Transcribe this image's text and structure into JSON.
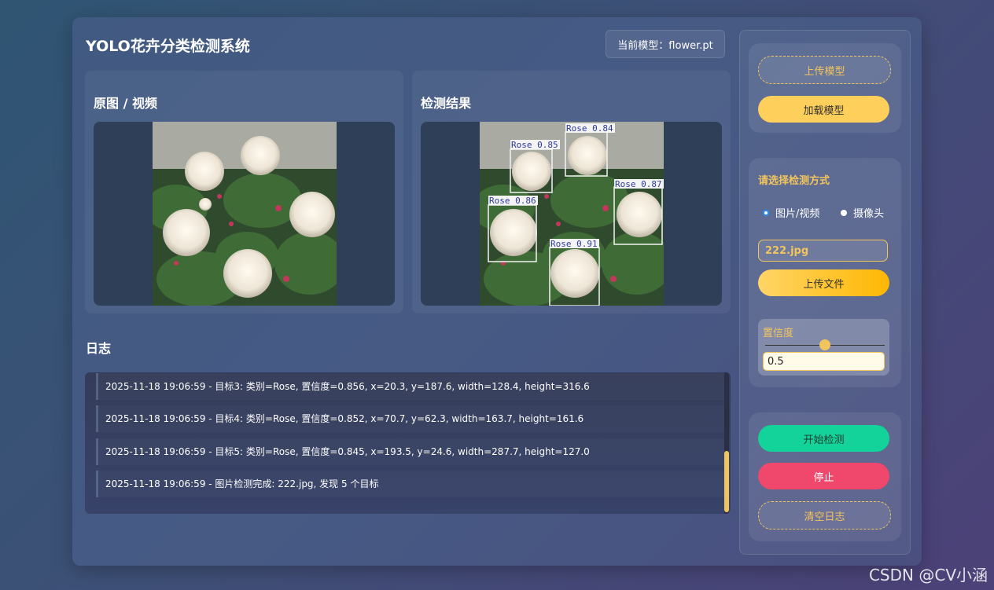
{
  "app": {
    "title": "YOLO花卉分类检测系统",
    "model_badge": "当前模型：flower.pt"
  },
  "panels": {
    "original_title": "原图 / 视频",
    "result_title": "检测结果"
  },
  "detections": [
    {
      "label": "Rose 0.85"
    },
    {
      "label": "Rose 0.84"
    },
    {
      "label": "Rose 0.87"
    },
    {
      "label": "Rose 0.86"
    },
    {
      "label": "Rose 0.91"
    }
  ],
  "log": {
    "title": "日志",
    "lines": [
      "2025-11-18 19:06:59 - 目标3: 类别=Rose, 置信度=0.856, x=20.3, y=187.6, width=128.4, height=316.6",
      "2025-11-18 19:06:59 - 目标4: 类别=Rose, 置信度=0.852, x=70.7, y=62.3, width=163.7, height=161.6",
      "2025-11-18 19:06:59 - 目标5: 类别=Rose, 置信度=0.845, x=193.5, y=24.6, width=287.7, height=127.0",
      "2025-11-18 19:06:59 - 图片检测完成: 222.jpg, 发现 5 个目标"
    ]
  },
  "sidebar": {
    "upload_model": "上传模型",
    "load_model": "加载模型",
    "detect_mode_title": "请选择检测方式",
    "mode_image": "图片/视频",
    "mode_camera": "摄像头",
    "file_name": "222.jpg",
    "upload_file": "上传文件",
    "confidence_label": "置信度",
    "confidence_value": "0.5",
    "confidence_fraction": 0.5,
    "start_detect": "开始检测",
    "stop": "停止",
    "clear_log": "清空日志"
  },
  "colors": {
    "accent": "#f2c45d",
    "green": "#13d39a",
    "red": "#f0476d"
  },
  "watermark": "CSDN @CV小涵"
}
